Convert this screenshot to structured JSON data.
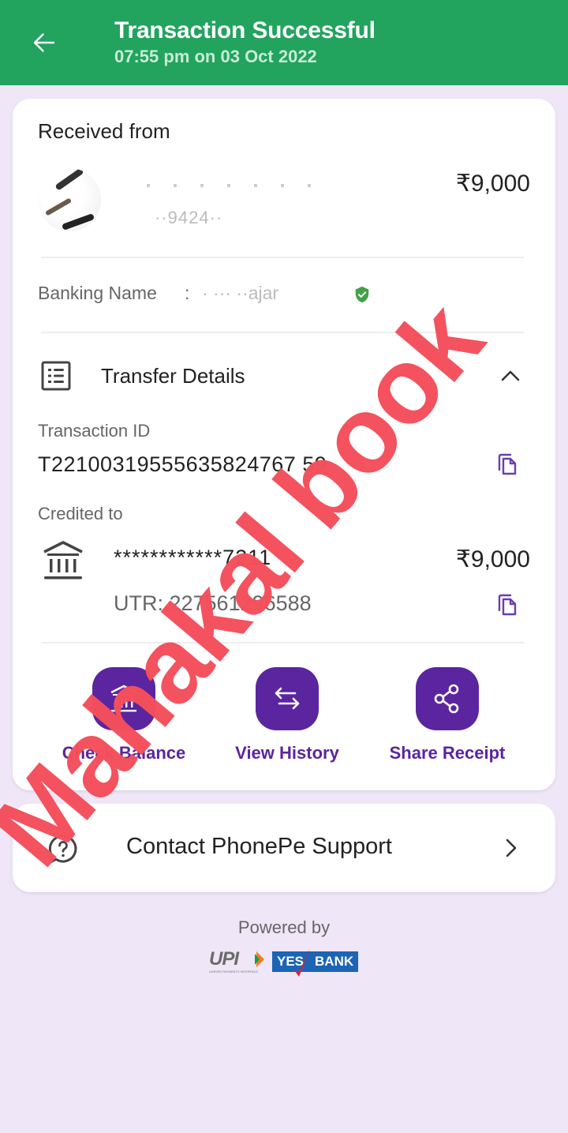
{
  "header": {
    "title": "Transaction Successful",
    "subtitle": "07:55 pm on 03 Oct 2022",
    "back_icon": "arrow-left-icon",
    "color": "#22a35e"
  },
  "received": {
    "label": "Received from",
    "sender_name": "",
    "sender_phone": "··9424··",
    "amount": "₹9,000"
  },
  "banking": {
    "label": "Banking Name",
    "separator": ":",
    "value": "·  ···       ··ajar",
    "verified_icon": "verified-shield-icon"
  },
  "transfer_details": {
    "title": "Transfer Details",
    "expanded": true,
    "transaction_id_label": "Transaction ID",
    "transaction_id": "T22100319555635824767 59",
    "credited_to_label": "Credited to",
    "account": "************7211",
    "account_amount": "₹9,000",
    "utr": "UTR: 227561296588"
  },
  "actions": [
    {
      "label": "Check Balance",
      "icon": "bank-icon"
    },
    {
      "label": "View History",
      "icon": "swap-arrows-icon"
    },
    {
      "label": "Share Receipt",
      "icon": "share-icon"
    }
  ],
  "support": {
    "label": "Contact PhonePe Support",
    "icon": "help-chat-icon"
  },
  "footer": {
    "powered_by": "Powered by",
    "upi_logo": "UPI",
    "upi_tagline": "UNIFIED PAYMENTS INTERFACE",
    "bank_logo_left": "YES",
    "bank_logo_right": "BANK"
  },
  "watermark": "Mahakal book",
  "colors": {
    "accent_purple": "#5b259f",
    "background": "#efe6f7",
    "watermark": "#f44f5c"
  }
}
